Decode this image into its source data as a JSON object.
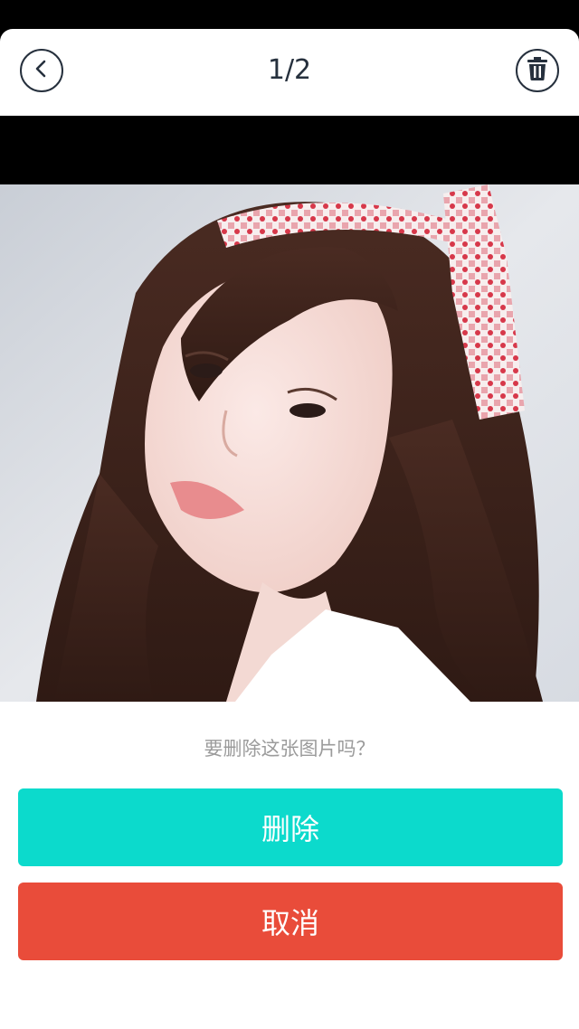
{
  "header": {
    "title": "1/2",
    "back_icon": "chevron-left-icon",
    "trash_icon": "trash-icon"
  },
  "photo": {
    "subject": "portrait-photo"
  },
  "dialog": {
    "prompt": "要删除这张图片吗？",
    "delete_label": "删除",
    "cancel_label": "取消"
  },
  "colors": {
    "delete": "#0cdacc",
    "cancel": "#e94c3a",
    "icon_stroke": "#26303d"
  }
}
